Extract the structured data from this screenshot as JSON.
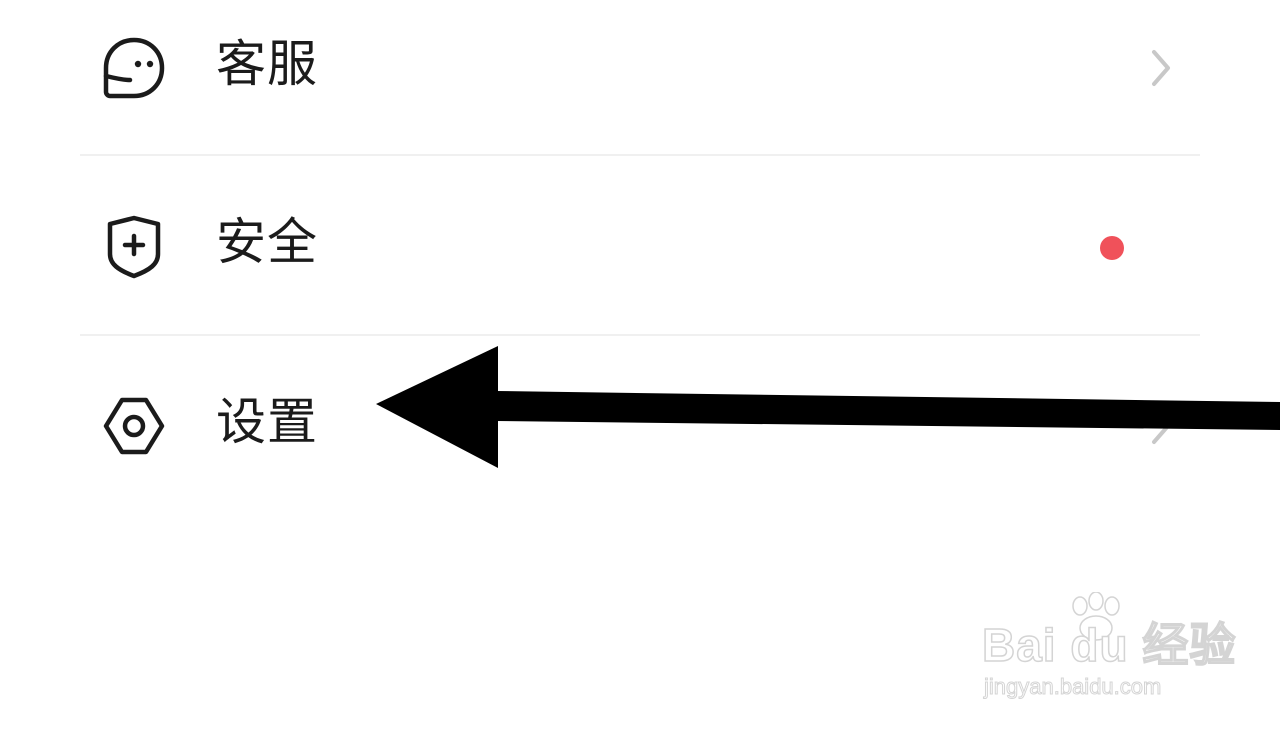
{
  "menu": {
    "items": [
      {
        "label": "客服",
        "icon": "customer-service-icon",
        "has_chevron": true
      },
      {
        "label": "安全",
        "icon": "shield-plus-icon",
        "has_badge": true
      },
      {
        "label": "设置",
        "icon": "hexagon-settings-icon",
        "has_chevron": true
      }
    ]
  },
  "annotation": {
    "arrow_target": "设置",
    "arrow_color": "#000000"
  },
  "watermark": {
    "brand": "Bai du 经验",
    "url": "jingyan.baidu.com"
  },
  "colors": {
    "badge": "#f0515a",
    "text": "#1b1b1b",
    "divider": "#f0f0f0",
    "chevron": "#c8c8c8"
  }
}
